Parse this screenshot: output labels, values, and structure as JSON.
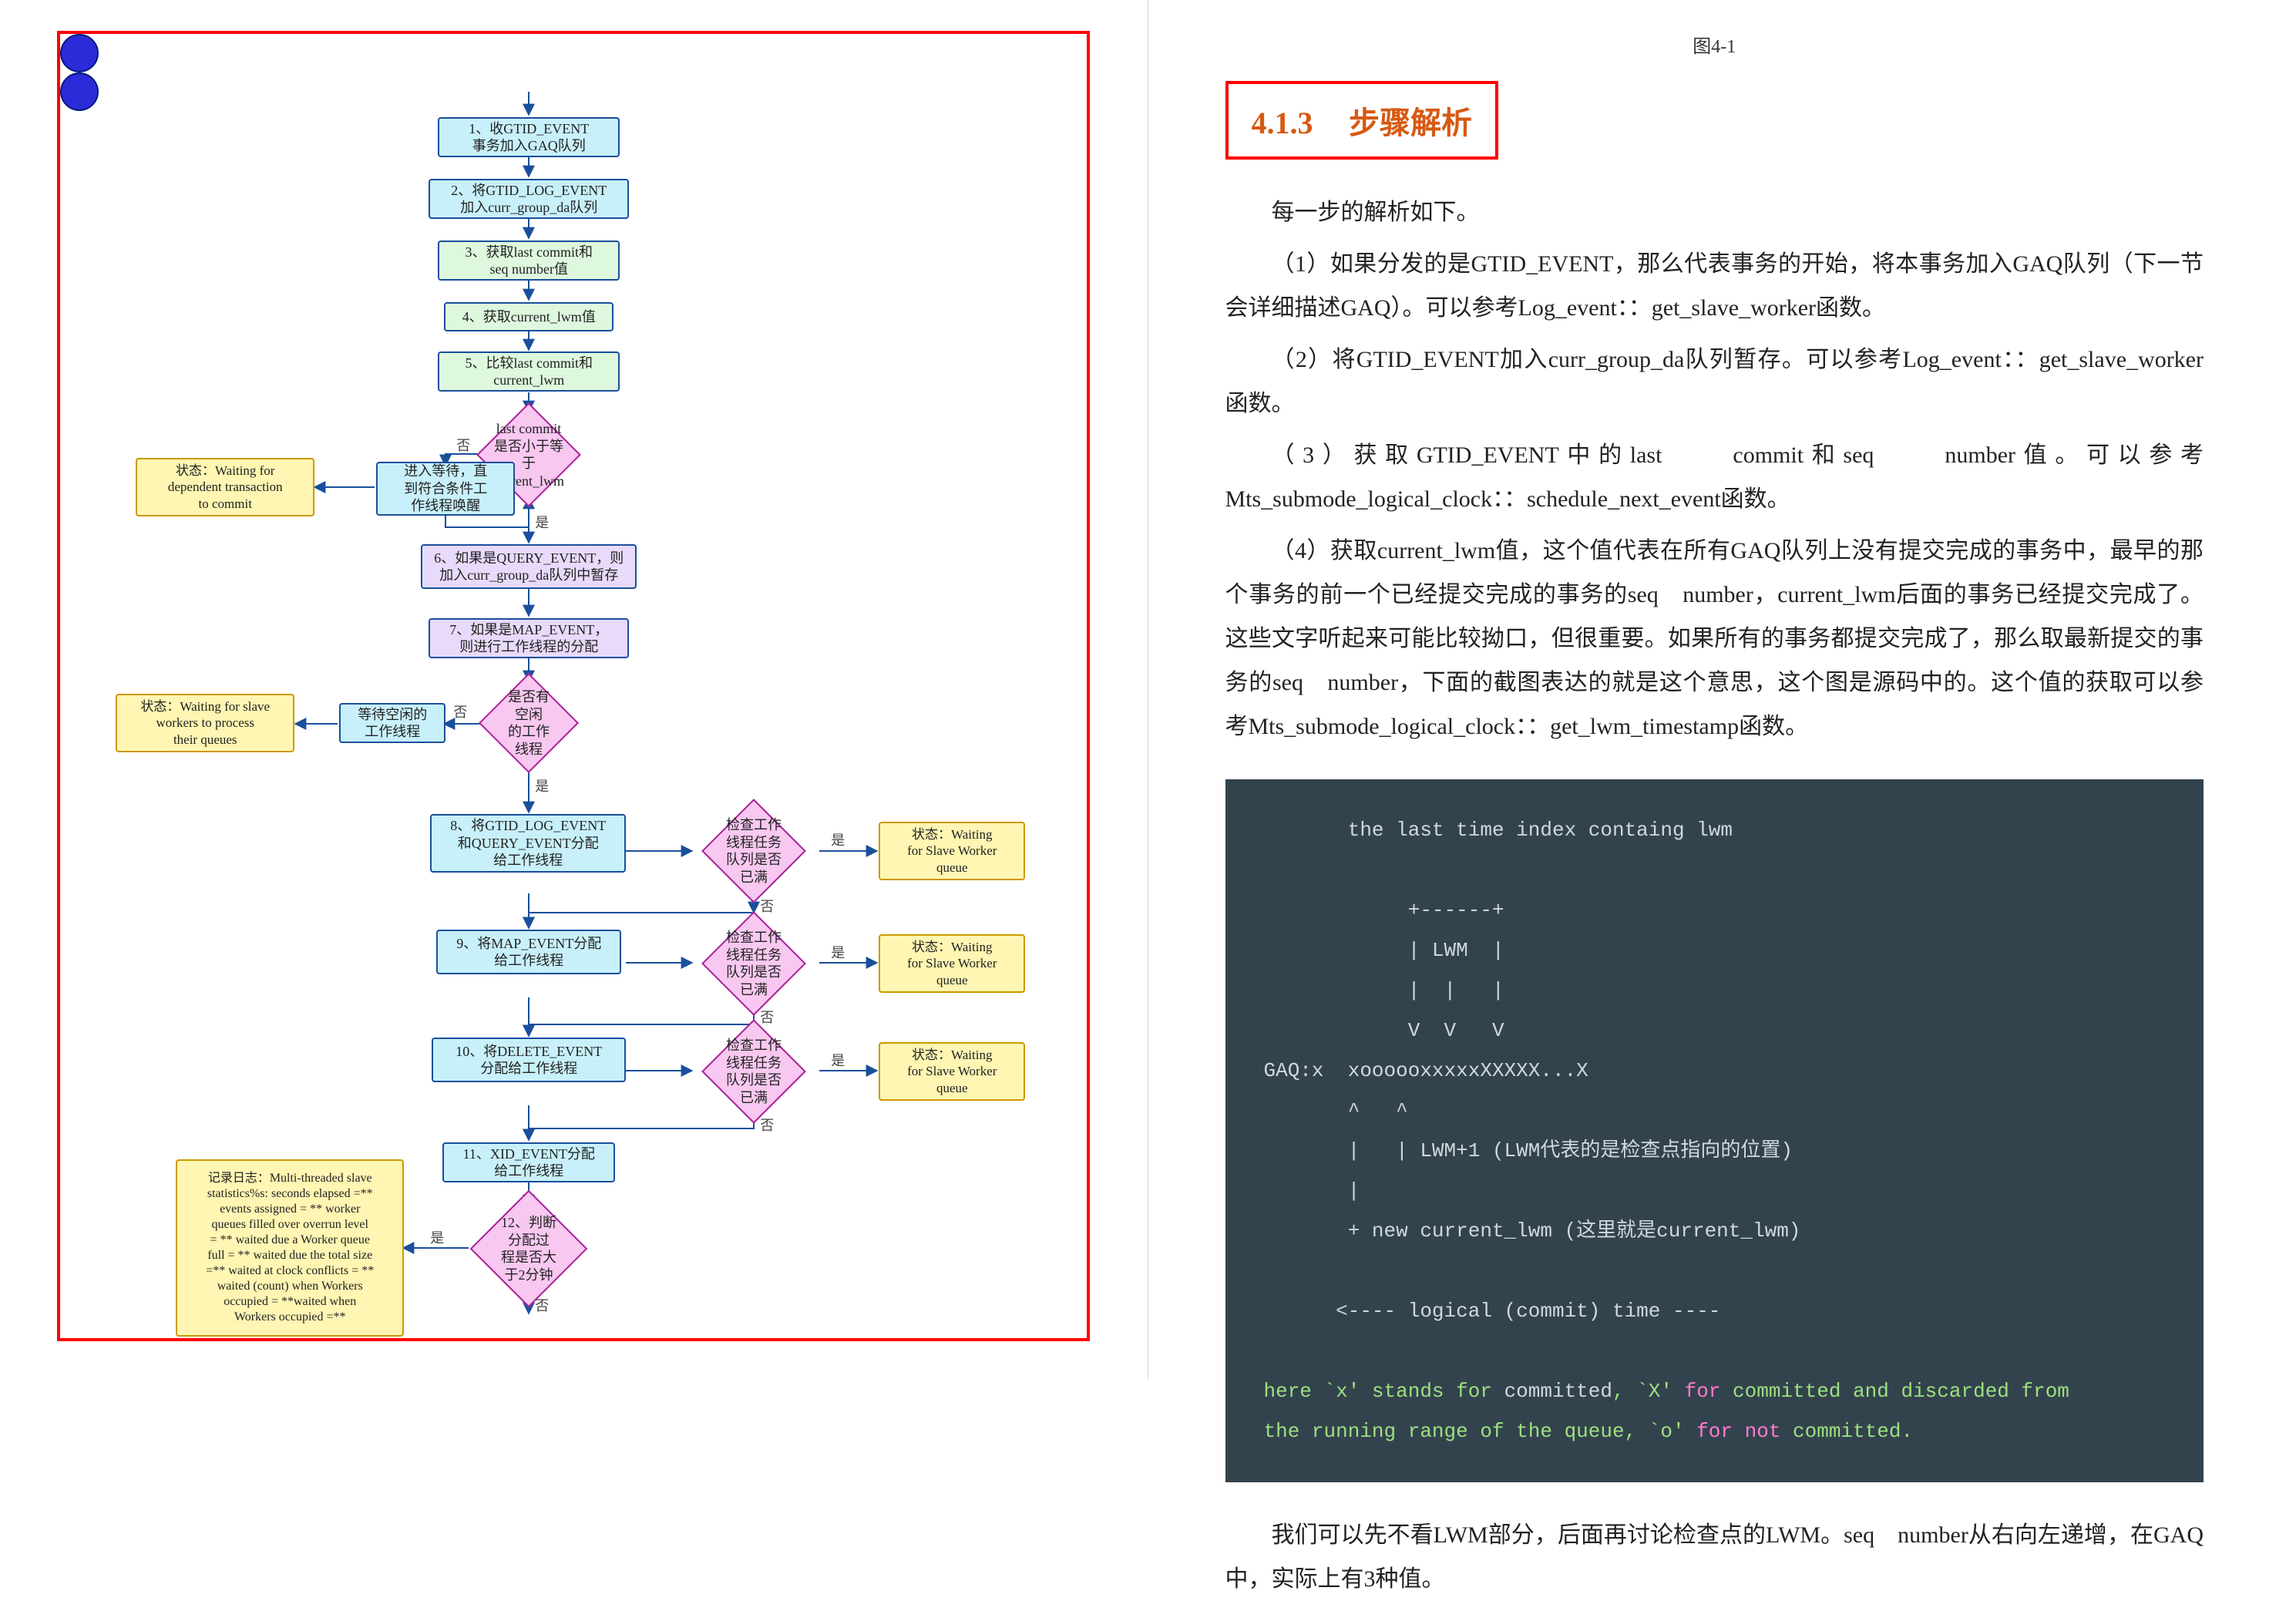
{
  "left": {
    "flow": {
      "start": "",
      "n1": "1、收GTID_EVENT\n事务加入GAQ队列",
      "n2": "2、将GTID_LOG_EVENT\n加入curr_group_da队列",
      "n3": "3、获取last commit和\nseq number值",
      "n4": "4、获取current_lwm值",
      "n5": "5、比较last commit和\ncurrent_lwm",
      "d1": "last commit\n是否小于等于\ncurrent_lwm",
      "w1": "进入等待，直\n到符合条件工\n作线程唤醒",
      "s1": "状态：Waiting for\ndependent transaction\nto commit",
      "n6": "6、如果是QUERY_EVENT，则\n加入curr_group_da队列中暂存",
      "n7": "7、如果是MAP_EVENT，\n则进行工作线程的分配",
      "d2": "是否有空闲\n的工作线程",
      "w2": "等待空闲的\n工作线程",
      "s2": "状态：Waiting for slave\nworkers to process\ntheir queues",
      "n8": "8、将GTID_LOG_EVENT\n和QUERY_EVENT分配\n给工作线程",
      "d3": "检查工作\n线程任务队列是否\n已满",
      "s3": "状态：Waiting\nfor Slave Worker\nqueue",
      "n9": "9、将MAP_EVENT分配\n给工作线程",
      "d4": "检查工作\n线程任务队列是否\n已满",
      "s4": "状态：Waiting\nfor Slave Worker\nqueue",
      "n10": "10、将DELETE_EVENT\n分配给工作线程",
      "d5": "检查工作\n线程任务队列是否\n已满",
      "s5": "状态：Waiting\nfor Slave Worker\nqueue",
      "n11": "11、XID_EVENT分配\n给工作线程",
      "d6": "12、判断分配过\n程是否大于2分钟",
      "s6": "记录日志：Multi-threaded slave\nstatistics%s: seconds elapsed =**\nevents assigned = ** worker\nqueues filled over overrun level\n= ** waited due a Worker queue\nfull = ** waited due the total size\n=** waited at clock conflicts = **\nwaited (count) when Workers\noccupied = **waited when\nWorkers occupied =**",
      "end": ""
    },
    "edge_labels": {
      "yes": "是",
      "no": "否"
    }
  },
  "right": {
    "caption": "图4-1",
    "section_num": "4.1.3",
    "section_title": "步骤解析",
    "p0": "每一步的解析如下。",
    "p1": "（1）如果分发的是GTID_EVENT，那么代表事务的开始，将本事务加入GAQ队列（下一节会详细描述GAQ）。可以参考Log_event：：get_slave_worker函数。",
    "p2": "（2）将GTID_EVENT加入curr_group_da队列暂存。可以参考Log_event：：get_slave_worker函数。",
    "p3": "（3）获取GTID_EVENT中的last　　commit和seq　　number值。可以参考Mts_submode_logical_clock：：schedule_next_event函数。",
    "p4": "（4）获取current_lwm值，这个值代表在所有GAQ队列上没有提交完成的事务中，最早的那个事务的前一个已经提交完成的事务的seq　number，current_lwm后面的事务已经提交完成了。这些文字听起来可能比较拗口，但很重要。如果所有的事务都提交完成了，那么取最新提交的事务的seq　number，下面的截图表达的就是这个意思，这个图是源码中的。这个值的获取可以参考Mts_submode_logical_clock：：get_lwm_timestamp函数。",
    "code_lines": [
      "       the last time index containg lwm",
      "",
      "            +------+",
      "            | LWM  |",
      "            |  |   |",
      "            V  V   V",
      "GAQ:x  xoooooxxxxxXXXXX...X",
      "       ^   ^",
      "       |   | LWM+1 (LWM代表的是检查点指向的位置)",
      "       |",
      "       + new current_lwm (这里就是current_lwm)",
      "",
      "      <---- logical (commit) time ----",
      ""
    ],
    "code_foot1_a": "here `x' stands for ",
    "code_foot1_b": "committed",
    "code_foot1_c": ", `X' ",
    "code_foot1_d": "for",
    "code_foot1_e": " committed and discarded from",
    "code_foot2_a": "the running range of the queue, `o' ",
    "code_foot2_b": "for not",
    "code_foot2_c": " committed.",
    "p5": "我们可以先不看LWM部分，后面再讨论检查点的LWM。seq　number从右向左递增，在GAQ中，实际上有3种值。"
  }
}
